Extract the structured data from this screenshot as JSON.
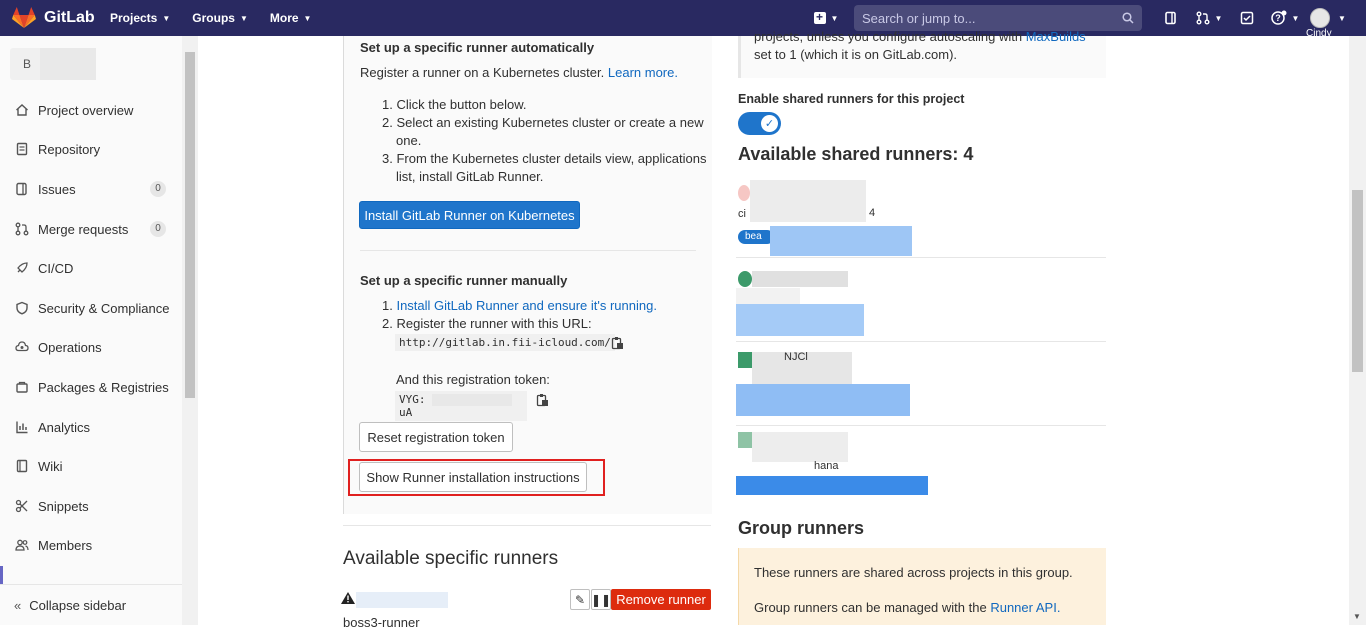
{
  "navbar": {
    "brand": "GitLab",
    "menu": [
      {
        "label": "Projects"
      },
      {
        "label": "Groups"
      },
      {
        "label": "More"
      }
    ],
    "search_placeholder": "Search or jump to...",
    "user_name": "Cindy",
    "bg_color": "#292961"
  },
  "sidebar": {
    "project_initial": "B",
    "items": [
      {
        "label": "Project overview",
        "icon": "home-icon"
      },
      {
        "label": "Repository",
        "icon": "doc-icon"
      },
      {
        "label": "Issues",
        "icon": "issues-icon",
        "count": "0"
      },
      {
        "label": "Merge requests",
        "icon": "merge-request-icon",
        "count": "0"
      },
      {
        "label": "CI/CD",
        "icon": "rocket-icon"
      },
      {
        "label": "Security & Compliance",
        "icon": "shield-icon"
      },
      {
        "label": "Operations",
        "icon": "cloud-gear-icon"
      },
      {
        "label": "Packages & Registries",
        "icon": "package-icon"
      },
      {
        "label": "Analytics",
        "icon": "chart-icon"
      },
      {
        "label": "Wiki",
        "icon": "book-icon"
      },
      {
        "label": "Snippets",
        "icon": "snippet-icon"
      },
      {
        "label": "Members",
        "icon": "users-icon"
      }
    ],
    "collapse_label": "Collapse sidebar"
  },
  "auto_setup": {
    "heading": "Set up a specific runner automatically",
    "intro": "Register a runner on a Kubernetes cluster.",
    "learn_more": "Learn more.",
    "steps": [
      "Click the button below.",
      "Select an existing Kubernetes cluster or create a new",
      "one.",
      "From the Kubernetes cluster details view, applications",
      "list, install GitLab Runner."
    ],
    "install_button": "Install GitLab Runner on Kubernetes"
  },
  "manual_setup": {
    "heading": "Set up a specific runner manually",
    "step1_link": "Install GitLab Runner and ensure it's running.",
    "step2": "Register the runner with this URL:",
    "url": "http://gitlab.in.fii-icloud.com/",
    "token_label": "And this registration token:",
    "token_start": "VYG:",
    "token_end": "uA",
    "reset_button": "Reset registration token",
    "instructions_button": "Show Runner installation instructions"
  },
  "specific_runners": {
    "heading": "Available specific runners",
    "runner_name": "boss3-runner",
    "remove_button": "Remove runner"
  },
  "shared": {
    "info_line1": "projects, unless you configure autoscaling with",
    "info_link": "MaxBuilds",
    "info_line2": "set to 1 (which it is on GitLab.com).",
    "enable_label": "Enable shared runners for this project",
    "heading": "Available shared runners: 4",
    "runner1_suffix": "4",
    "runner1_prefix": "ci",
    "runner1_tag": "bea",
    "runner3_frag": "NJCl",
    "runner4_frag": "hana"
  },
  "group": {
    "heading": "Group runners",
    "line1": "These runners are shared across projects in this group.",
    "line2_prefix": "Group runners can be managed with the",
    "line2_link": "Runner API."
  }
}
